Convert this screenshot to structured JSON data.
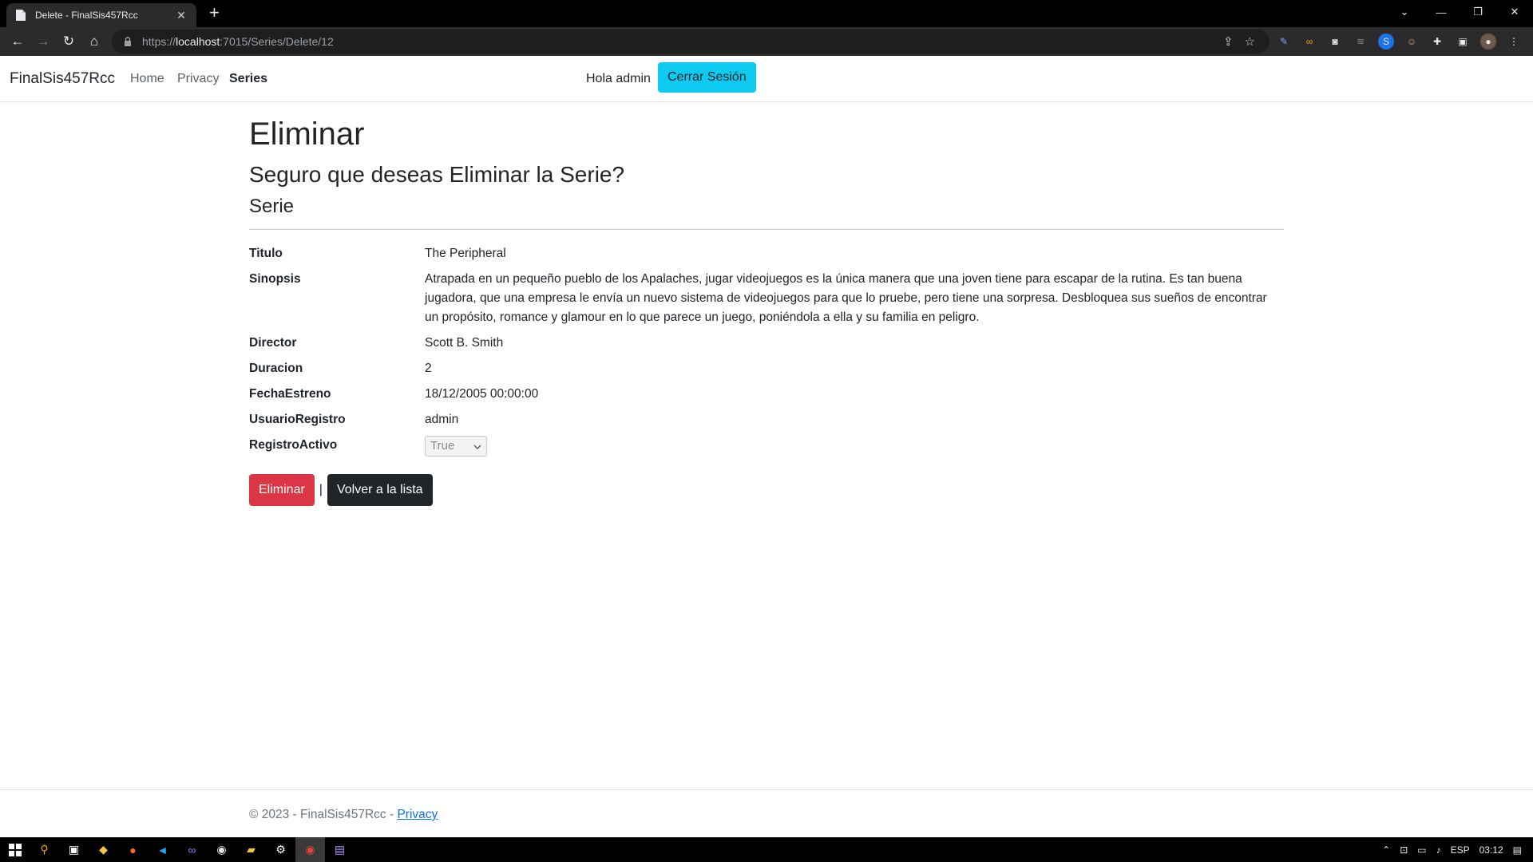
{
  "browser": {
    "tab_title": "Delete - FinalSis457Rcc",
    "url_scheme": "https://",
    "url_host": "localhost",
    "url_path": ":7015/Series/Delete/12"
  },
  "navbar": {
    "brand": "FinalSis457Rcc",
    "links": [
      "Home",
      "Privacy",
      "Series"
    ],
    "greeting": "Hola admin",
    "logout": "Cerrar Sesión"
  },
  "page": {
    "title": "Eliminar",
    "question": "Seguro que deseas Eliminar la Serie?",
    "entity": "Serie"
  },
  "details": [
    {
      "label": "Titulo",
      "value": "The Peripheral"
    },
    {
      "label": "Sinopsis",
      "value": "Atrapada en un pequeño pueblo de los Apalaches, jugar videojuegos es la única manera que una joven tiene para escapar de la rutina. Es tan buena jugadora, que una empresa le envía un nuevo sistema de videojuegos para que lo pruebe, pero tiene una sorpresa. Desbloquea sus sueños de encontrar un propósito, romance y glamour en lo que parece un juego, poniéndola a ella y su familia en peligro."
    },
    {
      "label": "Director",
      "value": "Scott B. Smith"
    },
    {
      "label": "Duracion",
      "value": "2"
    },
    {
      "label": "FechaEstreno",
      "value": "18/12/2005 00:00:00"
    },
    {
      "label": "UsuarioRegistro",
      "value": "admin"
    },
    {
      "label": "RegistroActivo",
      "value": "True"
    }
  ],
  "actions": {
    "delete": "Eliminar",
    "separator": "|",
    "back": "Volver a la lista"
  },
  "footer": {
    "text": "© 2023 - FinalSis457Rcc - ",
    "link": "Privacy"
  },
  "taskbar": {
    "language": "ESP",
    "time": "03:12"
  },
  "colors": {
    "danger": "#dc3545",
    "info": "#0dcaf0",
    "dark": "#212529",
    "link": "#0d6efd"
  }
}
